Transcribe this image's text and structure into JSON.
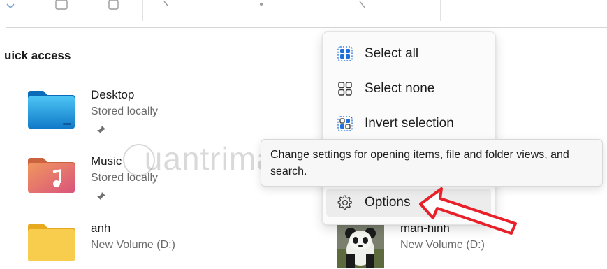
{
  "quick_access": {
    "title": "uick access",
    "items": [
      {
        "name": "Desktop",
        "location": "Stored locally",
        "pinned": true,
        "icon": "desktop-folder-icon"
      },
      {
        "name": "Music",
        "location": "Stored locally",
        "pinned": true,
        "icon": "music-folder-icon"
      },
      {
        "name": "anh",
        "location": "New Volume (D:)",
        "pinned": false,
        "icon": "folder-icon"
      },
      {
        "name": "man-hinh",
        "location": "New Volume (D:)",
        "pinned": false,
        "icon": "panda-thumbnail"
      }
    ]
  },
  "context_menu": {
    "items": [
      {
        "label": "Select all",
        "icon": "select-all-icon"
      },
      {
        "label": "Select none",
        "icon": "select-none-icon"
      },
      {
        "label": "Invert selection",
        "icon": "invert-selection-icon"
      },
      {
        "label": "Options",
        "icon": "gear-icon",
        "highlighted": true
      }
    ]
  },
  "tooltip": {
    "text": "Change settings for opening items, file and folder views, and search."
  },
  "colors": {
    "accent": "#1e6fd9",
    "annotation_arrow": "#e8202a",
    "folder_yellow": "#f6c544",
    "desktop_blue": "#1c9be0",
    "music_folder": "#e87a5a"
  }
}
